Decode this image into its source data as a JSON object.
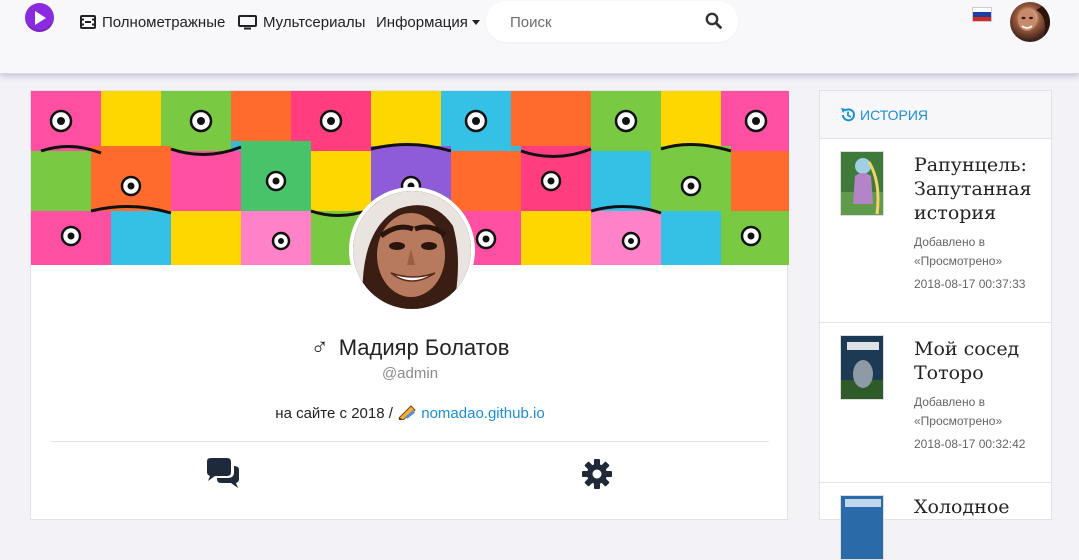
{
  "header": {
    "nav": [
      {
        "label": "Полнометражные",
        "icon": "film-icon"
      },
      {
        "label": "Мультсериалы",
        "icon": "monitor-icon"
      },
      {
        "label": "Информация",
        "icon": "caret-down-icon"
      }
    ],
    "search_placeholder": "Поиск",
    "language_flag": "ru",
    "colors": {
      "logo": "#8a2be2",
      "link": "#1a8fd6"
    }
  },
  "profile": {
    "gender_symbol": "♂",
    "name": "Мадияр Болатов",
    "login": "@admin",
    "since_text": "на сайте с 2018 /",
    "website": "nomadao.github.io",
    "actions": [
      {
        "icon": "chat-icon"
      },
      {
        "icon": "gear-icon"
      }
    ]
  },
  "history": {
    "title": "История",
    "items": [
      {
        "title": "Рапунцель: Запутанная история",
        "note": "Добавлено в «Просмотрено»",
        "date": "2018-08-17 00:37:33"
      },
      {
        "title": "Мой сосед Тоторо",
        "note": "Добавлено в «Просмотрено»",
        "date": "2018-08-17 00:32:42"
      },
      {
        "title": "Холодное"
      }
    ]
  }
}
